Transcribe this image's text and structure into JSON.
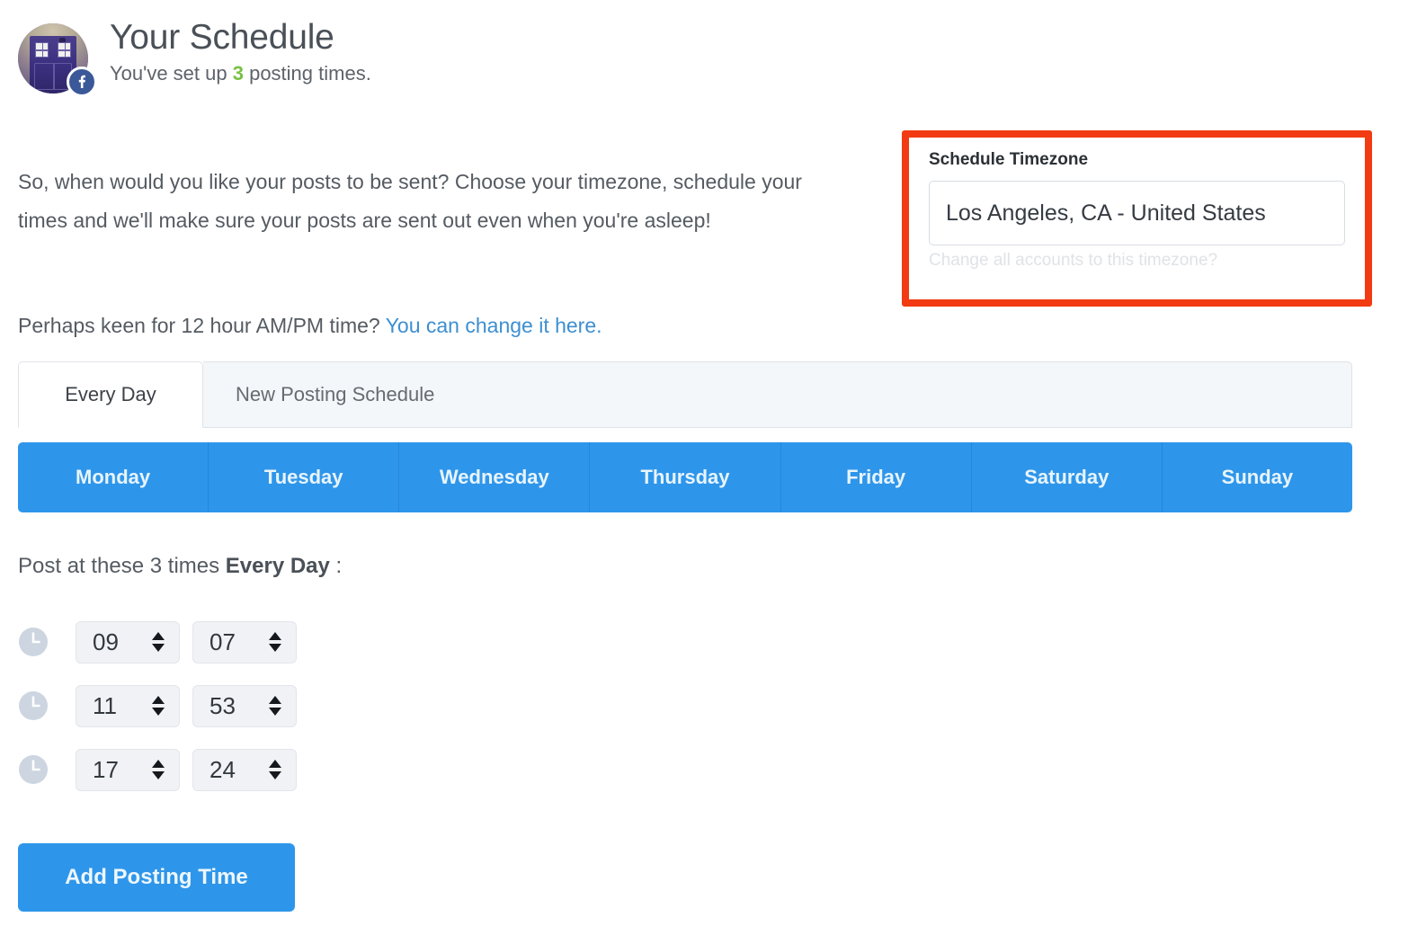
{
  "header": {
    "title": "Your Schedule",
    "subtitle_prefix": "You've set up ",
    "subtitle_count": "3",
    "subtitle_suffix": " posting times.",
    "avatar_name": "tardis-avatar",
    "network_badge": "facebook-icon",
    "count_color": "#78c043"
  },
  "intro": {
    "paragraph1": "So, when would you like your posts to be sent? Choose your timezone, schedule your times and we'll make sure your posts are sent out even when you're asleep!",
    "paragraph2_prefix": "Perhaps keen for 12 hour AM/PM time? ",
    "link_text": "You can change it here.",
    "link_color": "#3d8fd1"
  },
  "timezone_panel": {
    "label": "Schedule Timezone",
    "selected_value": "Los Angeles, CA - United States",
    "options": [
      "Los Angeles, CA - United States"
    ],
    "sub_link": "Change all accounts to this timezone?",
    "highlight_color": "#f23b12"
  },
  "tabs": [
    {
      "label": "Every Day",
      "active": true
    },
    {
      "label": "New Posting Schedule",
      "active": false
    }
  ],
  "days": [
    "Monday",
    "Tuesday",
    "Wednesday",
    "Thursday",
    "Friday",
    "Saturday",
    "Sunday"
  ],
  "days_color": "#2e96ea",
  "post_at": {
    "prefix": "Post at these 3 times ",
    "bold": "Every Day",
    "suffix": " :",
    "times_count": "3"
  },
  "times": [
    {
      "hour": "09",
      "minute": "07"
    },
    {
      "hour": "11",
      "minute": "53"
    },
    {
      "hour": "17",
      "minute": "24"
    }
  ],
  "add_button": {
    "label": "Add Posting Time",
    "color": "#2e96ea"
  }
}
